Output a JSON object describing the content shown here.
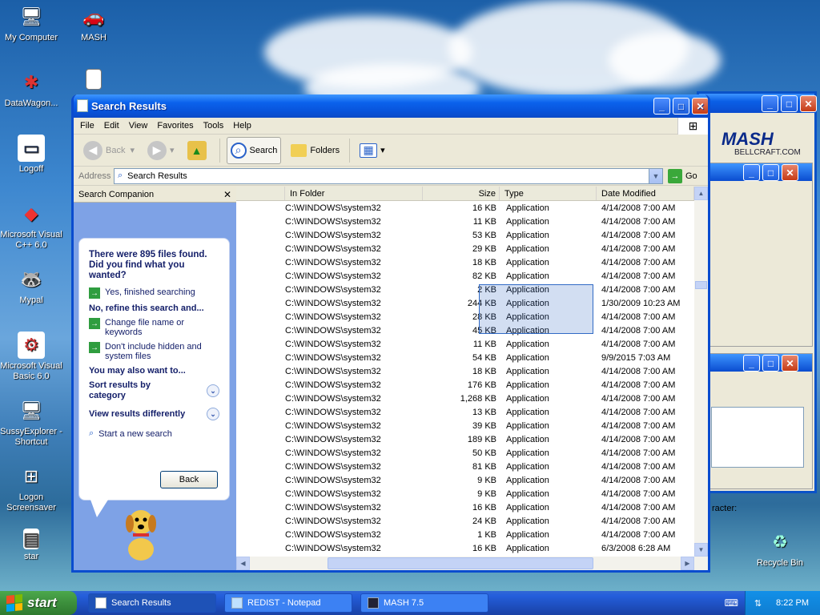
{
  "desktop": {
    "icons": [
      {
        "label": "My Computer",
        "glyph": "🖥"
      },
      {
        "label": "MASH",
        "glyph": "🚗"
      },
      {
        "label": "DataWagon...",
        "glyph": "✱"
      },
      {
        "label": "Logoff",
        "glyph": "▭"
      },
      {
        "label": "Microsoft Visual C++ 6.0",
        "glyph": "◆"
      },
      {
        "label": "Mypal",
        "glyph": "🦝"
      },
      {
        "label": "Microsoft Visual Basic 6.0",
        "glyph": "⚙"
      },
      {
        "label": "SussyExplorer - Shortcut",
        "glyph": "🖥"
      },
      {
        "label": "Logon Screensaver",
        "glyph": "⊞"
      },
      {
        "label": "star",
        "glyph": "▤"
      },
      {
        "label": "Recycle Bin",
        "glyph": "♻"
      }
    ]
  },
  "mash_window": {
    "logo": "MASH",
    "sub": "BELLCRAFT.COM",
    "status_label": "racter:"
  },
  "window": {
    "title": "Search Results",
    "menu": [
      "File",
      "Edit",
      "View",
      "Favorites",
      "Tools",
      "Help"
    ],
    "toolbar": {
      "back": "Back",
      "search": "Search",
      "folders": "Folders"
    },
    "address_label": "Address",
    "address_value": "Search Results",
    "go_label": "Go"
  },
  "companion": {
    "header": "Search Companion",
    "found_text": "There were 895 files found. Did you find what you wanted?",
    "yes_option": "Yes, finished searching",
    "refine_heading": "No, refine this search and...",
    "refine_options": [
      "Change file name or keywords",
      "Don't include hidden and system files"
    ],
    "also_heading": "You may also want to...",
    "sort_option": "Sort results by category",
    "view_option": "View results differently",
    "new_search": "Start a new search",
    "back_button": "Back"
  },
  "list": {
    "columns": [
      "In Folder",
      "Size",
      "Type",
      "Date Modified"
    ],
    "rows": [
      {
        "folder": "C:\\WINDOWS\\system32",
        "size": "16 KB",
        "type": "Application",
        "date": "4/14/2008 7:00 AM"
      },
      {
        "folder": "C:\\WINDOWS\\system32",
        "size": "11 KB",
        "type": "Application",
        "date": "4/14/2008 7:00 AM"
      },
      {
        "folder": "C:\\WINDOWS\\system32",
        "size": "53 KB",
        "type": "Application",
        "date": "4/14/2008 7:00 AM"
      },
      {
        "folder": "C:\\WINDOWS\\system32",
        "size": "29 KB",
        "type": "Application",
        "date": "4/14/2008 7:00 AM"
      },
      {
        "folder": "C:\\WINDOWS\\system32",
        "size": "18 KB",
        "type": "Application",
        "date": "4/14/2008 7:00 AM"
      },
      {
        "folder": "C:\\WINDOWS\\system32",
        "size": "82 KB",
        "type": "Application",
        "date": "4/14/2008 7:00 AM"
      },
      {
        "folder": "C:\\WINDOWS\\system32",
        "size": "2 KB",
        "type": "Application",
        "date": "4/14/2008 7:00 AM"
      },
      {
        "folder": "C:\\WINDOWS\\system32",
        "size": "244 KB",
        "type": "Application",
        "date": "1/30/2009 10:23 AM"
      },
      {
        "folder": "C:\\WINDOWS\\system32",
        "size": "28 KB",
        "type": "Application",
        "date": "4/14/2008 7:00 AM"
      },
      {
        "folder": "C:\\WINDOWS\\system32",
        "size": "45 KB",
        "type": "Application",
        "date": "4/14/2008 7:00 AM"
      },
      {
        "folder": "C:\\WINDOWS\\system32",
        "size": "11 KB",
        "type": "Application",
        "date": "4/14/2008 7:00 AM"
      },
      {
        "folder": "C:\\WINDOWS\\system32",
        "size": "54 KB",
        "type": "Application",
        "date": "9/9/2015 7:03 AM"
      },
      {
        "folder": "C:\\WINDOWS\\system32",
        "size": "18 KB",
        "type": "Application",
        "date": "4/14/2008 7:00 AM"
      },
      {
        "folder": "C:\\WINDOWS\\system32",
        "size": "176 KB",
        "type": "Application",
        "date": "4/14/2008 7:00 AM"
      },
      {
        "folder": "C:\\WINDOWS\\system32",
        "size": "1,268 KB",
        "type": "Application",
        "date": "4/14/2008 7:00 AM"
      },
      {
        "folder": "C:\\WINDOWS\\system32",
        "size": "13 KB",
        "type": "Application",
        "date": "4/14/2008 7:00 AM"
      },
      {
        "folder": "C:\\WINDOWS\\system32",
        "size": "39 KB",
        "type": "Application",
        "date": "4/14/2008 7:00 AM"
      },
      {
        "folder": "C:\\WINDOWS\\system32",
        "size": "189 KB",
        "type": "Application",
        "date": "4/14/2008 7:00 AM"
      },
      {
        "folder": "C:\\WINDOWS\\system32",
        "size": "50 KB",
        "type": "Application",
        "date": "4/14/2008 7:00 AM"
      },
      {
        "folder": "C:\\WINDOWS\\system32",
        "size": "81 KB",
        "type": "Application",
        "date": "4/14/2008 7:00 AM"
      },
      {
        "folder": "C:\\WINDOWS\\system32",
        "size": "9 KB",
        "type": "Application",
        "date": "4/14/2008 7:00 AM"
      },
      {
        "folder": "C:\\WINDOWS\\system32",
        "size": "9 KB",
        "type": "Application",
        "date": "4/14/2008 7:00 AM"
      },
      {
        "folder": "C:\\WINDOWS\\system32",
        "size": "16 KB",
        "type": "Application",
        "date": "4/14/2008 7:00 AM"
      },
      {
        "folder": "C:\\WINDOWS\\system32",
        "size": "24 KB",
        "type": "Application",
        "date": "4/14/2008 7:00 AM"
      },
      {
        "folder": "C:\\WINDOWS\\system32",
        "size": "1 KB",
        "type": "Application",
        "date": "4/14/2008 7:00 AM"
      },
      {
        "folder": "C:\\WINDOWS\\system32",
        "size": "16 KB",
        "type": "Application",
        "date": "6/3/2008 6:28 AM"
      }
    ]
  },
  "taskbar": {
    "start": "start",
    "tasks": [
      "Search Results",
      "REDIST - Notepad",
      "MASH 7.5"
    ],
    "clock": "8:22 PM"
  }
}
